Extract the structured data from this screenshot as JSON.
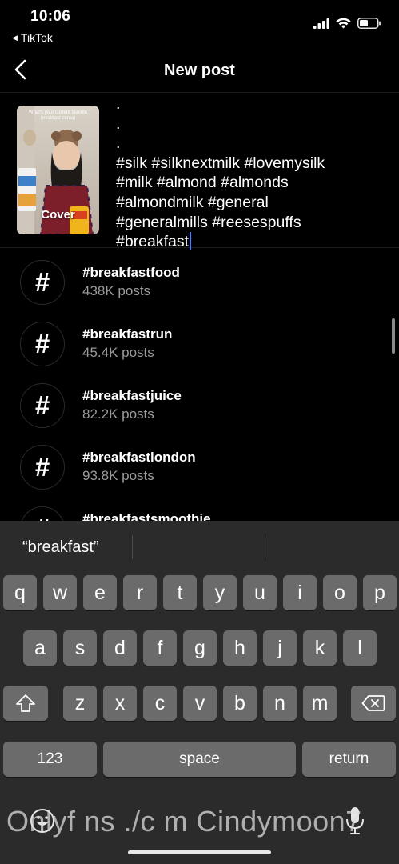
{
  "status_bar": {
    "time": "10:06",
    "back_app": "TikTok",
    "icons": [
      "signal-icon",
      "wifi-icon",
      "battery-icon"
    ]
  },
  "nav": {
    "title": "New post",
    "back_icon": "chevron-left-icon"
  },
  "cover": {
    "label": "Cover",
    "overlay_text": "What's your current favorite breakfast cereal"
  },
  "caption": {
    "text": ".\n.\n.\n#silk #silknextmilk #lovemysilk\n#milk #almond #almonds\n#almondmilk #general\n#generalmills #reesespuffs\n#breakfast"
  },
  "suggestions": [
    {
      "tag": "#breakfastfood",
      "count": "438K posts"
    },
    {
      "tag": "#breakfastrun",
      "count": "45.4K posts"
    },
    {
      "tag": "#breakfastjuice",
      "count": "82.2K posts"
    },
    {
      "tag": "#breakfastlondon",
      "count": "93.8K posts"
    },
    {
      "tag": "#breakfastsmoothie",
      "count": ""
    }
  ],
  "keyboard": {
    "prediction": "“breakfast”",
    "row1": [
      "q",
      "w",
      "e",
      "r",
      "t",
      "y",
      "u",
      "i",
      "o",
      "p"
    ],
    "row2": [
      "a",
      "s",
      "d",
      "f",
      "g",
      "h",
      "j",
      "k",
      "l"
    ],
    "row3": [
      "z",
      "x",
      "c",
      "v",
      "b",
      "n",
      "m"
    ],
    "numbers_label": "123",
    "space_label": "space",
    "return_label": "return",
    "icons": [
      "shift-icon",
      "delete-icon",
      "emoji-icon",
      "microphone-icon"
    ]
  },
  "watermark": "Onlyf ns ./c m Cindymoon7"
}
